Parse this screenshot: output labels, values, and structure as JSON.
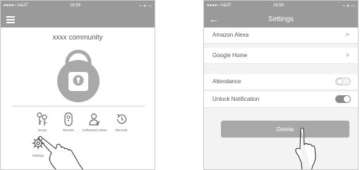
{
  "screen1": {
    "status": {
      "carrier": "●●●●○ A&AT",
      "time": "16:59",
      "right_icons": "⌁ ∗ ▭"
    },
    "community_name": "xxxx community",
    "functions": [
      {
        "label": "eKeys",
        "icon": "ekeys-icon"
      },
      {
        "label": "Remote",
        "icon": "remote-icon"
      },
      {
        "label": "Authorized Admin",
        "icon": "authorized-admin-icon"
      },
      {
        "label": "Records",
        "icon": "records-icon"
      }
    ],
    "settings_label": "Settings"
  },
  "screen2": {
    "status": {
      "carrier": "●●●●○ A&AT",
      "time": "16:59",
      "right_icons": "⌁ ∗ ▭"
    },
    "title": "Settings",
    "rows": [
      {
        "label": "Amazon Alexa",
        "chevron": ">"
      },
      {
        "label": "Google Home",
        "chevron": ">"
      }
    ],
    "toggles": [
      {
        "label": "Attendance",
        "state": "off"
      },
      {
        "label": "Unlock Notification",
        "state": "on"
      }
    ],
    "delete_label": "Delete"
  },
  "colors": {
    "bar": "#9a9a9a",
    "lock_circle": "#a9a9a9",
    "button": "#a8a8a8"
  }
}
